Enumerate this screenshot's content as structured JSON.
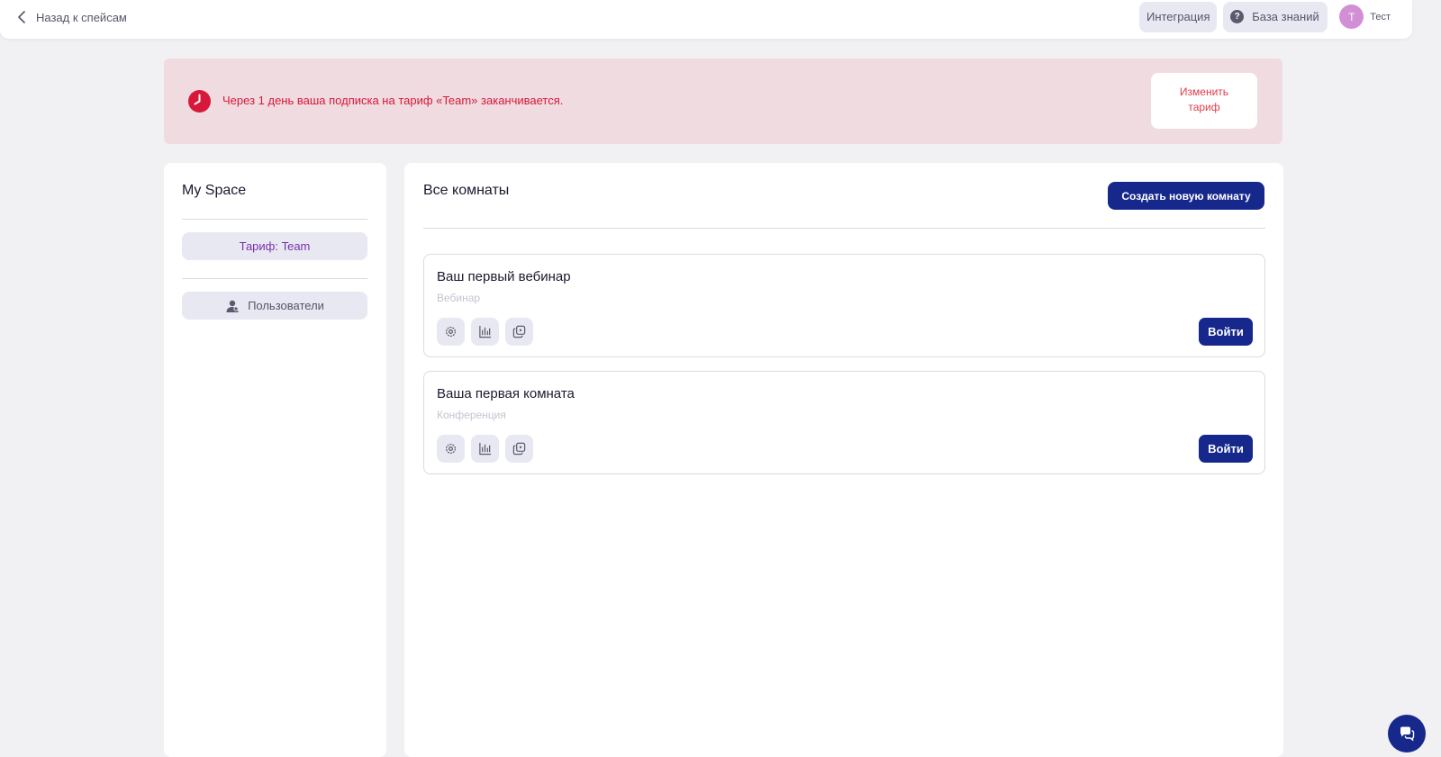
{
  "topbar": {
    "back_label": "Назад к спейсам",
    "integration_label": "Интеграция",
    "knowledge_base_label": "База знаний",
    "help_glyph": "?",
    "avatar_initial": "Т",
    "user_name": "Тест",
    "icons": {
      "back": "chevron-left-icon",
      "help": "question-icon"
    }
  },
  "alert": {
    "text": "Через 1 день ваша подписка на тариф «Team» заканчивается.",
    "change_plan_label": "Изменить\nтариф",
    "icon": "clock-icon",
    "color": "#d8183a"
  },
  "sidebar": {
    "space_title": "My Space",
    "tariff_label": "Тариф: Team",
    "users_label": "Пользователи",
    "icons": {
      "users": "user-icon"
    }
  },
  "main": {
    "title": "Все комнаты",
    "create_label": "Создать новую комнату",
    "rooms": [
      {
        "title": "Ваш первый вебинар",
        "type": "Вебинар",
        "enter_label": "Войти"
      },
      {
        "title": "Ваша первая комната",
        "type": "Конференция",
        "enter_label": "Войти"
      }
    ],
    "room_actions": [
      "settings-icon",
      "stats-icon",
      "copy-icon"
    ]
  },
  "colors": {
    "accent": "#16288c",
    "alert_bg": "#f0dbe1",
    "alert_text": "#d8183a",
    "tariff_text": "#7a2fa8",
    "avatar": "#d28fd6"
  }
}
